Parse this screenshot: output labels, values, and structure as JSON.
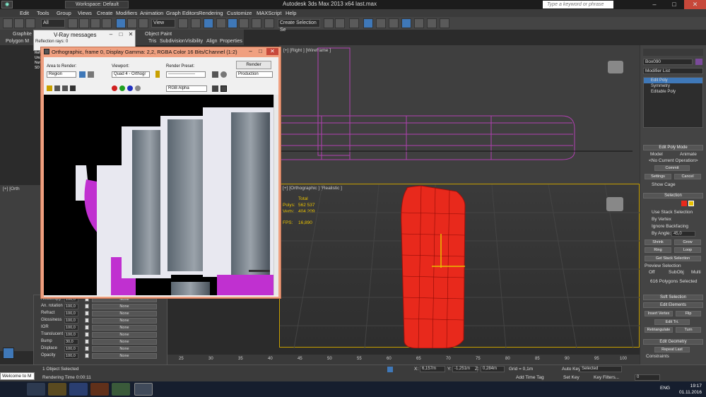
{
  "titlebar": {
    "workspace": "Workspace: Default",
    "app_title": "Autodesk 3ds Max  2013 x64      last.max",
    "help_search_placeholder": "Type a keyword or phrase"
  },
  "menu": [
    "Edit",
    "Tools",
    "Group",
    "Views",
    "Create",
    "Modifiers",
    "Animation",
    "Graph Editors",
    "Rendering",
    "Customize",
    "MAXScript",
    "Help"
  ],
  "toolbar": {
    "filter_select": "All",
    "refcoord_select": "View",
    "selection_set": "Create Selection Se"
  },
  "ribbon": {
    "tab1": "Graphite",
    "tab2": "Polygon M",
    "object_paint": "Object Paint",
    "tabs2": [
      "Tris",
      "Subdivision",
      "Visibility",
      "Align",
      "Properties"
    ]
  },
  "vray": {
    "title": "V-Ray messages",
    "line1": "Reflection rays: 0",
    "lines": [
      "Ref",
      "Unc",
      "Num",
      "SD"
    ]
  },
  "render_window": {
    "title": "Orthographic, frame 0, Display Gamma: 2,2, RGBA Color 16 Bits/Channel (1:2)",
    "area_label": "Area to Render:",
    "area_value": "Region",
    "viewport_label": "Viewport:",
    "viewport_value": "Quad 4 - Orthogr",
    "preset_label": "Render Preset:",
    "preset_value": "-------------------",
    "render_button": "Render",
    "mode_value": "Production",
    "channel_value": "RGB Alpha"
  },
  "material_params": [
    {
      "name": "Anisotropy",
      "value": "100,0",
      "map": "None"
    },
    {
      "name": "An. rotation",
      "value": "100,0",
      "map": "None"
    },
    {
      "name": "Refract",
      "value": "100,0",
      "map": "None"
    },
    {
      "name": "Glossiness",
      "value": "100,0",
      "map": "None"
    },
    {
      "name": "IOR",
      "value": "100,0",
      "map": "None"
    },
    {
      "name": "Translucent",
      "value": "100,0",
      "map": "None"
    },
    {
      "name": "Bump",
      "value": "30,0",
      "map": "None"
    },
    {
      "name": "Displace",
      "value": "100,0",
      "map": "None"
    },
    {
      "name": "Opacity",
      "value": "100,0",
      "map": "None"
    }
  ],
  "viewports": {
    "top_label": "[+] [Right ] [Wireframe ]",
    "persp_label": "[+] [Orthographic ] [Realistic ]",
    "leftbot_label": "[+] [Orth",
    "stats": {
      "total_label": "Total",
      "polys_label": "Polys:",
      "polys_value": "562 537",
      "verts_label": "Verts:",
      "verts_value": "404 209",
      "fps_label": "FPS:",
      "fps_value": "16,890"
    }
  },
  "command_panel": {
    "object_name": "Box090",
    "modifier_list": "Modifier List",
    "stack": [
      "Edit Poly",
      "Symmetry",
      "Editable Poly"
    ],
    "edit_poly_mode": "Edit Poly Mode",
    "model": "Model",
    "animate": "Animate",
    "no_op": "<No Current Operation>",
    "commit": "Commit",
    "settings": "Settings",
    "cancel": "Cancel",
    "show_cage": "Show Cage",
    "selection": "Selection",
    "use_stack": "Use Stack Selection",
    "by_vertex": "By Vertex",
    "ignore_backfacing": "Ignore Backfacing",
    "by_angle": "By Angle:",
    "by_angle_val": "45,0",
    "shrink": "Shrink",
    "grow": "Grow",
    "ring": "Ring",
    "loop": "Loop",
    "get_stack": "Get Stack Selection",
    "preview_selection": "Preview Selection",
    "off": "Off",
    "subobj": "SubObj",
    "multi": "Multi",
    "selected_count": "616 Polygons Selected",
    "soft_selection": "Soft Selection",
    "edit_elements": "Edit Elements",
    "insert_vertex": "Insert Vertex",
    "flip": "Flip",
    "edit_tri": "Edit Tri.",
    "retriangulate": "Retriangulate",
    "turn": "Turn",
    "edit_geometry": "Edit Geometry",
    "repeat_last": "Repeat Last",
    "constraints": "Constraints"
  },
  "timeline": {
    "ticks": [
      "25",
      "30",
      "35",
      "40",
      "45",
      "50",
      "55",
      "60",
      "65",
      "70",
      "75",
      "80",
      "85",
      "90",
      "95",
      "100"
    ]
  },
  "status": {
    "welcome": "Welcome to M",
    "selected": "1 Object Selected",
    "rendering_time": "Rendering Time  0:00:11",
    "x_label": "X:",
    "x_value": "6,157m",
    "y_label": "Y:",
    "y_value": "-1,251m",
    "z_label": "Z:",
    "z_value": "0,284m",
    "grid": "Grid = 0,1m",
    "add_time_tag": "Add Time Tag",
    "auto_key": "Auto Key",
    "set_key": "Set Key",
    "selected_dd": "Selected",
    "key_filters": "Key Filters...",
    "frame_value": "0"
  },
  "taskbar": {
    "lang": "ENG",
    "time": "19:17",
    "date": "01.11.2016"
  },
  "colors": {
    "accent": "#c8a000",
    "selection_red": "#e8291c",
    "magenta": "#c040c0",
    "render_frame": "#f0a080"
  }
}
